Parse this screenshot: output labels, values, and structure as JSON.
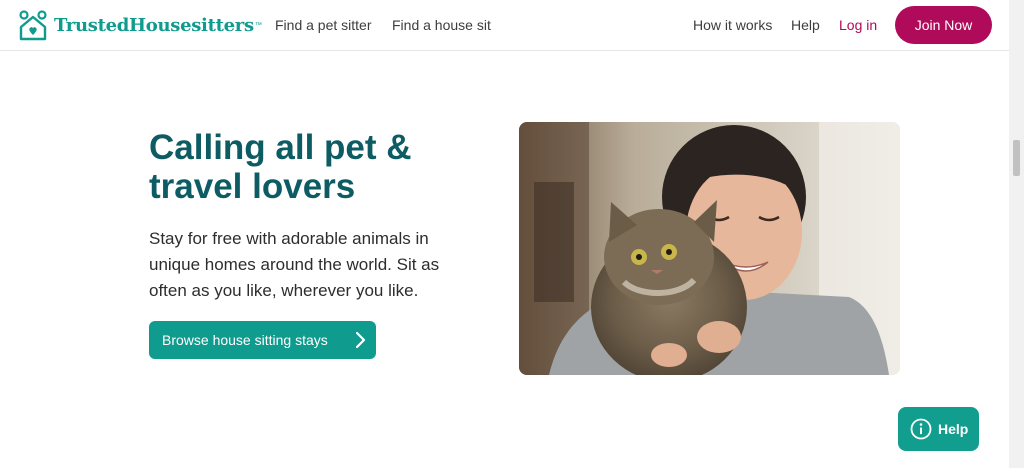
{
  "header": {
    "brand": "TrustedHousesitters",
    "brand_tm": "™",
    "nav_left": [
      "Find a pet sitter",
      "Find a house sit"
    ],
    "nav_right": {
      "how": "How it works",
      "help": "Help",
      "login": "Log in"
    },
    "join_label": "Join Now"
  },
  "hero": {
    "title": "Calling all pet & travel lovers",
    "text": "Stay for free with adorable animals in unique homes around the world. Sit as often as you like, wherever you like.",
    "cta_label": "Browse house sitting stays"
  },
  "help_button": {
    "label": "Help"
  },
  "colors": {
    "brand_teal": "#0f9b8e",
    "title_teal": "#0d5c63",
    "accent_magenta": "#b00b5a"
  },
  "icons": {
    "logo": "house-with-heart-icon",
    "cta": "chevron-right-icon",
    "help": "info-circle-icon"
  }
}
